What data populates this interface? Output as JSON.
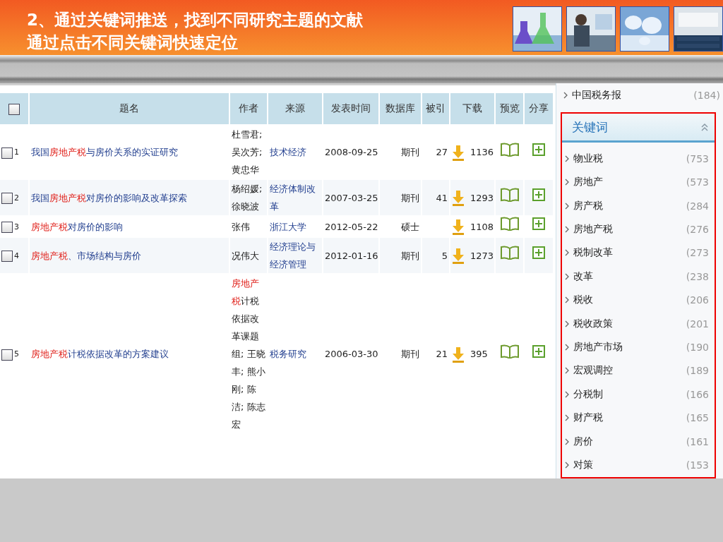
{
  "slide": {
    "title_lines": [
      "2、通过关键词推送，找到不同研究主题的文献",
      "通过点击不同关键词快速定位"
    ],
    "pictures": [
      {
        "kind": "picture"
      },
      {
        "kind": "picture"
      },
      {
        "kind": "picture"
      },
      {
        "kind": "picture"
      }
    ]
  },
  "table": {
    "select_all": {
      "checked": false
    },
    "columns": [
      "题名",
      "作者",
      "来源",
      "发表时间",
      "数据库",
      "被引",
      "下载",
      "预览",
      "分享"
    ],
    "rows": [
      {
        "index": "1",
        "checked": false,
        "title": [
          {
            "text": "我国",
            "highlight": false
          },
          {
            "text": "房地产税",
            "highlight": true
          },
          {
            "text": "与房价关系的实证研究",
            "highlight": false
          }
        ],
        "authors": [
          {
            "text": "杜雪君;吴次芳;黄忠华",
            "highlight": false
          }
        ],
        "source": "技术经济",
        "date": "2008-09-25",
        "database": "期刊",
        "cited": "27",
        "downloads": "1136"
      },
      {
        "index": "2",
        "checked": false,
        "title": [
          {
            "text": "我国",
            "highlight": false
          },
          {
            "text": "房地产税",
            "highlight": true
          },
          {
            "text": "对房价的影响及改革探索",
            "highlight": false
          }
        ],
        "authors": [
          {
            "text": "杨绍媛;徐晓波",
            "highlight": false
          }
        ],
        "source": "经济体制改革",
        "date": "2007-03-25",
        "database": "期刊",
        "cited": "41",
        "downloads": "1293"
      },
      {
        "index": "3",
        "checked": false,
        "title": [
          {
            "text": "房地产税",
            "highlight": true
          },
          {
            "text": "对房价的影响",
            "highlight": false
          }
        ],
        "authors": [
          {
            "text": "张伟",
            "highlight": false
          }
        ],
        "source": "浙江大学",
        "date": "2012-05-22",
        "database": "硕士",
        "downloads": "1108"
      },
      {
        "index": "4",
        "checked": false,
        "title": [
          {
            "text": "房地产税",
            "highlight": true
          },
          {
            "text": "、市场结构与房价",
            "highlight": false
          }
        ],
        "authors": [
          {
            "text": "况伟大",
            "highlight": false
          }
        ],
        "source": "经济理论与经济管理",
        "date": "2012-01-16",
        "database": "期刊",
        "cited": "5",
        "downloads": "1273"
      },
      {
        "index": "5",
        "checked": false,
        "title": [
          {
            "text": "房地产税",
            "highlight": true
          },
          {
            "text": "计税依据改革的方案建议",
            "highlight": false
          }
        ],
        "authors": [
          {
            "text": "房地产税",
            "highlight": true
          },
          {
            "text": "计税依据改革课题组; 王晓丰; 熊小刚; 陈洁; 陈志宏",
            "highlight": false
          }
        ],
        "source": "税务研究",
        "date": "2006-03-30",
        "database": "期刊",
        "cited": "21",
        "downloads": "395"
      }
    ]
  },
  "sidebar": {
    "previous_item": {
      "label": "中国税务报",
      "count": "(184)"
    },
    "section": {
      "title": "关键词",
      "expanded": true,
      "highlighted": true,
      "items": [
        {
          "label": "物业税",
          "count": "(753"
        },
        {
          "label": "房地产",
          "count": "(573"
        },
        {
          "label": "房产税",
          "count": "(284"
        },
        {
          "label": "房地产税",
          "count": "(276"
        },
        {
          "label": "税制改革",
          "count": "(273"
        },
        {
          "label": "改革",
          "count": "(238"
        },
        {
          "label": "税收",
          "count": "(206"
        },
        {
          "label": "税收政策",
          "count": "(201"
        },
        {
          "label": "房地产市场",
          "count": "(190"
        },
        {
          "label": "宏观调控",
          "count": "(189"
        },
        {
          "label": "分税制",
          "count": "(166"
        },
        {
          "label": "财产税",
          "count": "(165"
        },
        {
          "label": "房价",
          "count": "(161"
        },
        {
          "label": "对策",
          "count": "(153"
        }
      ]
    }
  }
}
